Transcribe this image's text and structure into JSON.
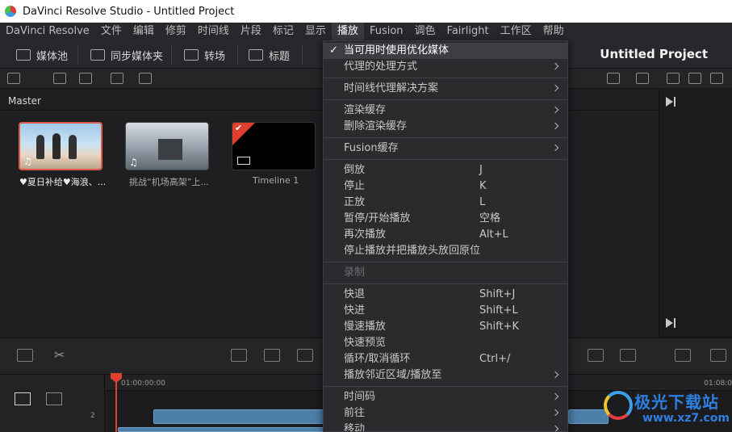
{
  "window": {
    "title": "DaVinci Resolve Studio - Untitled Project"
  },
  "menubar": {
    "items": [
      "DaVinci Resolve",
      "文件",
      "编辑",
      "修剪",
      "时间线",
      "片段",
      "标记",
      "显示",
      "播放",
      "Fusion",
      "调色",
      "Fairlight",
      "工作区",
      "帮助"
    ],
    "active_index": 8
  },
  "toolbar": {
    "media_pool": "媒体池",
    "sync_bin": "同步媒体夹",
    "transitions": "转场",
    "titles": "标题",
    "project_title": "Untitled Project"
  },
  "media_pool": {
    "bin_name": "Master",
    "clips": [
      {
        "label": "♥夏日补给♥海浪、...",
        "selected": true
      },
      {
        "label": "挑战“机场高架”上...",
        "selected": false
      },
      {
        "label": "Timeline 1",
        "selected": false
      }
    ]
  },
  "timeline": {
    "timecode_start": "01:00:00:00",
    "timecode_end": "01:08:0",
    "track_number": "2"
  },
  "dropdown": {
    "items": [
      {
        "label": "当可用时使用优化媒体",
        "checked": true,
        "highlight": true
      },
      {
        "label": "代理的处理方式",
        "submenu": true
      },
      {
        "label": "时间线代理解决方案",
        "submenu": true
      },
      {
        "label": "渲染缓存",
        "submenu": true
      },
      {
        "label": "删除渲染缓存",
        "submenu": true
      },
      {
        "label": "Fusion缓存",
        "submenu": true
      },
      {
        "label": "倒放",
        "shortcut": "J"
      },
      {
        "label": "停止",
        "shortcut": "K"
      },
      {
        "label": "正放",
        "shortcut": "L"
      },
      {
        "label": "暂停/开始播放",
        "shortcut": "空格"
      },
      {
        "label": "再次播放",
        "shortcut": "Alt+L"
      },
      {
        "label": "停止播放并把播放头放回原位"
      },
      {
        "label": "录制",
        "disabled": true
      },
      {
        "label": "快退",
        "shortcut": "Shift+J"
      },
      {
        "label": "快进",
        "shortcut": "Shift+L"
      },
      {
        "label": "慢速播放",
        "shortcut": "Shift+K"
      },
      {
        "label": "快速预览"
      },
      {
        "label": "循环/取消循环",
        "shortcut": "Ctrl+/"
      },
      {
        "label": "播放邻近区域/播放至",
        "submenu": true
      },
      {
        "label": "时间码",
        "submenu": true
      },
      {
        "label": "前往",
        "submenu": true
      },
      {
        "label": "移动",
        "submenu": true
      }
    ]
  },
  "watermark": {
    "name": "极光下载站",
    "url": "www.xz7.com"
  },
  "colors": {
    "accent": "#e0402f",
    "clip_blue": "#4c7ea8",
    "watermark_blue": "#2f7fe0"
  }
}
